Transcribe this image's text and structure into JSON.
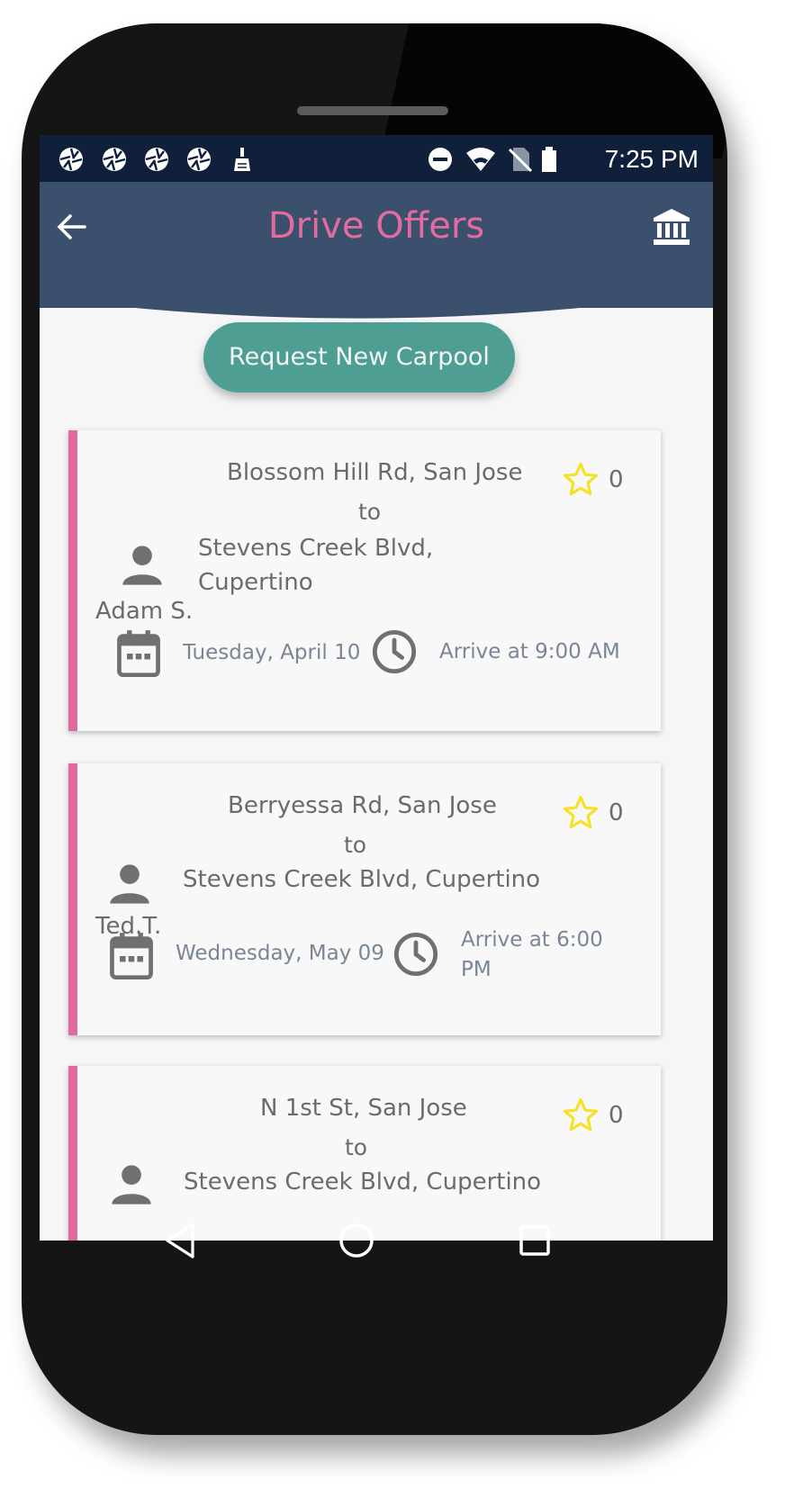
{
  "status_bar": {
    "time": "7:25 PM",
    "left_icons": [
      "aperture-icon",
      "aperture-icon",
      "aperture-icon",
      "aperture-icon",
      "cleaner-icon"
    ],
    "right_icons": [
      "do-not-disturb-icon",
      "wifi-icon",
      "no-sim-icon",
      "battery-icon"
    ]
  },
  "header": {
    "title": "Drive Offers",
    "back_icon": "arrow-left-icon",
    "action_icon": "bank-icon",
    "title_color": "#e36ba0",
    "bg_color": "#3b506d"
  },
  "request_button": {
    "label": "Request New Carpool",
    "color": "#4f9e93"
  },
  "offers": [
    {
      "from": "Blossom Hill Rd, San Jose",
      "connector": "to",
      "to_line1": "Stevens Creek Blvd,",
      "to_line2": "Cupertino",
      "rating": "0",
      "driver": "Adam S.",
      "date": "Tuesday, April 10",
      "arrive": "Arrive at 9:00 AM"
    },
    {
      "from": "Berryessa Rd, San Jose",
      "connector": "to",
      "to_line1": "Stevens Creek Blvd, Cupertino",
      "rating": "0",
      "driver": "Ted.T.",
      "date": "Wednesday, May 09",
      "arrive_line1": "Arrive at 6:00",
      "arrive_line2": "PM"
    },
    {
      "from": "N 1st St, San Jose",
      "connector": "to",
      "to_line1": "Stevens Creek Blvd, Cupertino",
      "rating": "0"
    }
  ],
  "accent_color": "#de6a9e",
  "star_color": "#f5e12a",
  "nav_bar": {
    "icons": [
      "back-triangle-icon",
      "home-circle-icon",
      "recents-square-icon"
    ]
  }
}
